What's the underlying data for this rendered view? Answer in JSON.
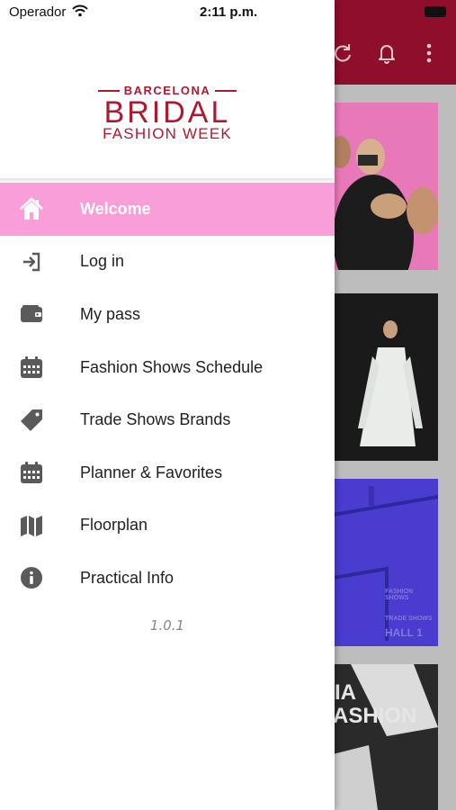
{
  "status_bar": {
    "carrier": "Operador",
    "time": "2:11 p.m."
  },
  "logo": {
    "line1": "BARCELONA",
    "line2": "BRIDAL",
    "line3": "FASHION WEEK",
    "color": "#b0182f"
  },
  "menu": {
    "items": [
      {
        "label": "Welcome",
        "icon": "home-icon",
        "active": true
      },
      {
        "label": "Log in",
        "icon": "login-icon",
        "active": false
      },
      {
        "label": "My pass",
        "icon": "wallet-icon",
        "active": false
      },
      {
        "label": "Fashion Shows Schedule",
        "icon": "calendar-icon",
        "active": false
      },
      {
        "label": "Trade Shows Brands",
        "icon": "tag-icon",
        "active": false
      },
      {
        "label": "Planner & Favorites",
        "icon": "calendar-icon",
        "active": false
      },
      {
        "label": "Floorplan",
        "icon": "map-icon",
        "active": false
      },
      {
        "label": "Practical Info",
        "icon": "info-icon",
        "active": false
      }
    ]
  },
  "version": "1.0.1",
  "background": {
    "topbar_color": "#8e0e2c",
    "icons": [
      "refresh-icon",
      "bell-icon",
      "more-vertical-icon"
    ],
    "card3_lines": [
      "FASHION SHOWS",
      "TRADE SHOWS",
      "HALL 1"
    ],
    "card4_lines": [
      "IA",
      "ASHION"
    ]
  },
  "colors": {
    "active_item_bg": "#fa9ed9",
    "icon_gray": "#5a5a5a"
  }
}
